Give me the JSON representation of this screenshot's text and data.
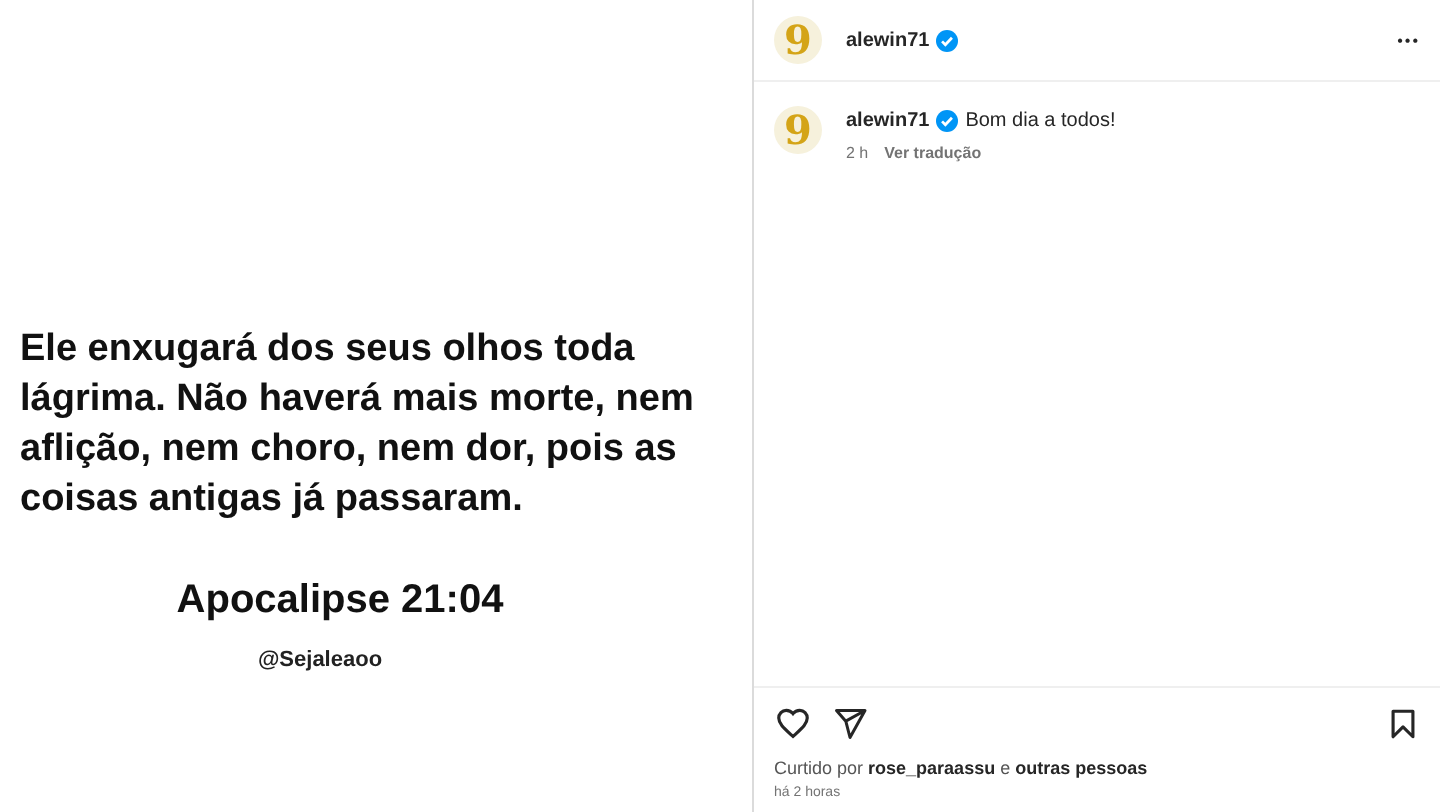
{
  "post_image": {
    "verse": "Ele enxugará dos seus olhos toda lágrima. Não haverá mais morte, nem aflição, nem choro, nem dor, pois as coisas antigas já passaram.",
    "reference": "Apocalipse  21:04",
    "handle": "@Sejaleaoo"
  },
  "header": {
    "avatar_text": "9",
    "username": "alewin71",
    "verified": true,
    "more": "•••"
  },
  "caption": {
    "avatar_text": "9",
    "username": "alewin71",
    "verified": true,
    "text": "Bom dia a todos!",
    "time": "2 h",
    "translate_link": "Ver tradução"
  },
  "actions": {
    "liked": false,
    "saved": false
  },
  "likes": "Curtido por **rose_paraassu** e **outras pessoas**",
  "timestamp": "há 2 horas"
}
